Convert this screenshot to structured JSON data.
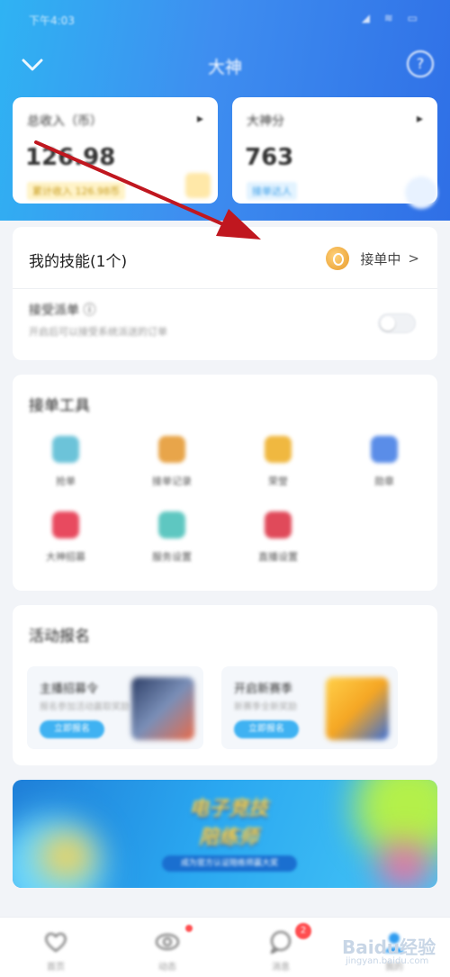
{
  "status_bar": {
    "time": "下午4:03",
    "icons": "◢ ≋ ▭"
  },
  "nav": {
    "title": "大神",
    "help": "?"
  },
  "stats": [
    {
      "label": "总收入（币）",
      "value": "126.98",
      "badge": "累计收入 126.98币"
    },
    {
      "label": "大神分",
      "value": "763",
      "badge": "接单达人"
    }
  ],
  "skill": {
    "title": "我的技能(1个)",
    "status": "接单中",
    "sub_title": "接受派单 ⓘ",
    "sub_desc": "开启后可以接受系统派送的订单"
  },
  "tools": {
    "title": "接单工具",
    "items": [
      {
        "label": "抢单",
        "icon": "clock-icon",
        "color": "#6cc3d9"
      },
      {
        "label": "接单记录",
        "icon": "notebook-icon",
        "color": "#e8a54a"
      },
      {
        "label": "荣誉",
        "icon": "trophy-icon",
        "color": "#f0b840"
      },
      {
        "label": "勋章",
        "icon": "medal-icon",
        "color": "#5a8de8"
      },
      {
        "label": "大神招募",
        "icon": "profile-icon",
        "color": "#e84a5f"
      },
      {
        "label": "服务设置",
        "icon": "gear-icon",
        "color": "#5ec7c1"
      },
      {
        "label": "直播设置",
        "icon": "mic-icon",
        "color": "#e04a5a"
      }
    ]
  },
  "activity": {
    "title": "活动报名",
    "promos": [
      {
        "title": "主播招募令",
        "desc": "报名参加活动赢取奖励",
        "button": "立即报名"
      },
      {
        "title": "开启新赛季",
        "desc": "新赛季全新奖励",
        "button": "立即报名"
      }
    ]
  },
  "banner": {
    "line1": "电子竞技",
    "line2": "陪练师",
    "sub": "成为官方认证陪练师赢大奖"
  },
  "tabbar": [
    {
      "label": "首页",
      "icon": "heart-icon"
    },
    {
      "label": "动态",
      "icon": "eye-icon",
      "dot": true
    },
    {
      "label": "消息",
      "icon": "chat-icon",
      "badge": "2"
    },
    {
      "label": "我的",
      "icon": "user-icon"
    }
  ],
  "watermark": {
    "text": "Baidu经验",
    "sub": "jingyan.baidu.com"
  },
  "colors": {
    "header_start": "#2fb3f3",
    "header_end": "#2f6fe6",
    "arrow": "#c0171f",
    "accent_blue": "#3fb2f2"
  }
}
